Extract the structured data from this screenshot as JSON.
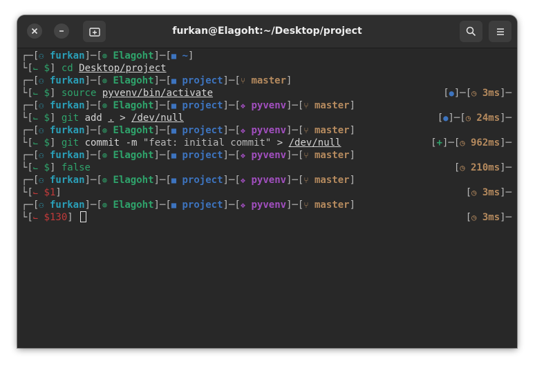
{
  "window": {
    "title": "furkan@Elagoht:~/Desktop/project",
    "icons": {
      "close": "close-icon",
      "minimize": "minimize-icon",
      "new_tab": "new-tab-icon",
      "search": "search-icon",
      "menu": "hamburger-menu-icon"
    }
  },
  "prompt": {
    "user": "furkan",
    "host": "Elagoht",
    "venv": "pyvenv",
    "branch": "master",
    "symbol": "$",
    "colors": {
      "user": "#2a9fb8",
      "host": "#2fa36b",
      "dir": "#3d74bf",
      "venv": "#a24fc0",
      "branch": "#b58a5e",
      "error": "#c23a3a"
    }
  },
  "blocks": [
    {
      "dir": "~",
      "cmd": "cd",
      "arg": "Desktop/project",
      "time": ""
    },
    {
      "dir": "project",
      "cmd": "source",
      "arg": "pyvenv/bin/activate",
      "time": "3ms"
    },
    {
      "dir": "project",
      "cmd": "git",
      "args_text": "add",
      "dot": ".",
      "redir": ">",
      "file": "/dev/null",
      "time": "24ms"
    },
    {
      "dir": "project",
      "cmd": "git",
      "args_text": "commit -m",
      "msg": "\"feat: initial commit\"",
      "redir": ">",
      "file": "/dev/null",
      "status": "+",
      "time": "962ms"
    },
    {
      "dir": "project",
      "cmd": "false",
      "time": "210ms"
    },
    {
      "dir": "project",
      "exit": "$1",
      "time": "3ms"
    },
    {
      "dir": "project",
      "exit": "$130",
      "time": "3ms"
    }
  ]
}
